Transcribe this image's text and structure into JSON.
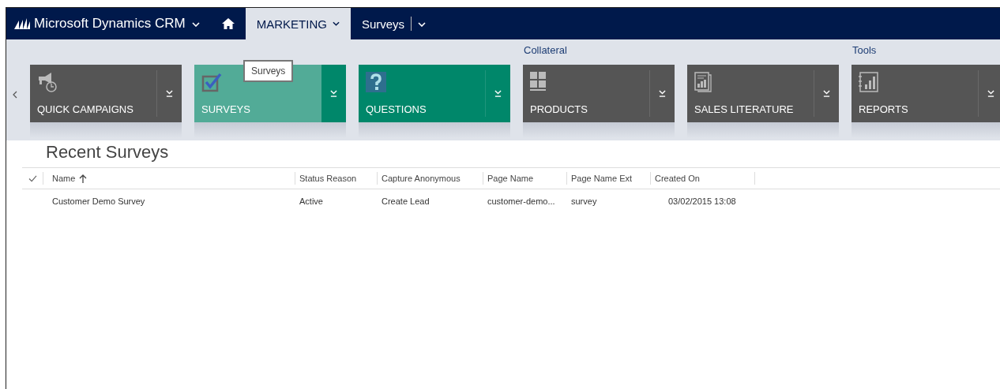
{
  "nav": {
    "app_title": "Microsoft Dynamics CRM",
    "area": "MARKETING",
    "area_selected": true,
    "entity": "Surveys"
  },
  "ribbon": {
    "tiles": [
      {
        "label": "QUICK CAMPAIGNS",
        "kind": "campaign",
        "hover": false
      },
      {
        "label": "SURVEYS",
        "kind": "survey",
        "hover": true
      },
      {
        "label": "QUESTIONS",
        "kind": "question",
        "hover": false
      },
      {
        "label": "PRODUCTS",
        "kind": "product",
        "hover": false,
        "group": "Collateral"
      },
      {
        "label": "SALES LITERATURE",
        "kind": "literature",
        "hover": false
      },
      {
        "label": "REPORTS",
        "kind": "report",
        "hover": false,
        "group": "Tools"
      }
    ],
    "tooltip": "Surveys"
  },
  "view_title": "Recent Surveys",
  "table": {
    "columns": [
      {
        "label": "Name",
        "sorted": true
      },
      {
        "label": "Status Reason",
        "sorted": false
      },
      {
        "label": "Capture Anonymous",
        "sorted": false
      },
      {
        "label": "Page Name",
        "sorted": false
      },
      {
        "label": "Page Name Ext",
        "sorted": false
      },
      {
        "label": "Created On",
        "sorted": false
      }
    ],
    "rows": [
      [
        "Customer Demo Survey",
        "Active",
        "Create Lead",
        "customer-demo...",
        "survey",
        "03/02/2015 13:08"
      ]
    ]
  }
}
